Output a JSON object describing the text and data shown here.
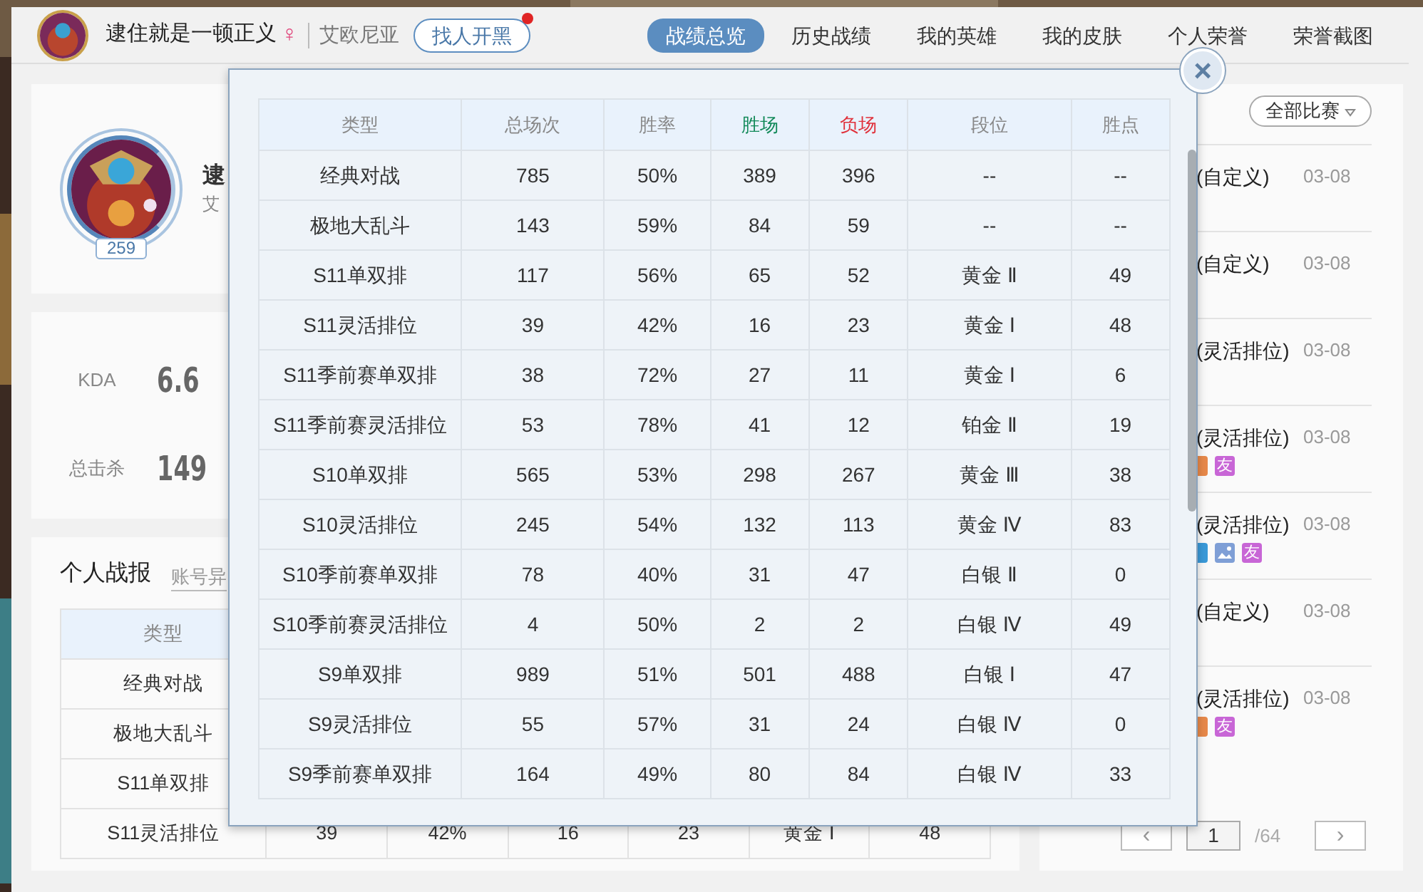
{
  "header": {
    "player_name": "逮住就是一顿正义",
    "gender_symbol": "♀",
    "server": "艾欧尼亚",
    "team_up_button": "找人开黑",
    "team_up_notification": true,
    "tabs": [
      {
        "label": "战绩总览",
        "selected": true
      },
      {
        "label": "历史战绩",
        "selected": false
      },
      {
        "label": "我的英雄",
        "selected": false
      },
      {
        "label": "我的皮肤",
        "selected": false
      },
      {
        "label": "个人荣誉",
        "selected": false
      },
      {
        "label": "荣誉截图",
        "selected": false
      }
    ]
  },
  "profile": {
    "level": "259",
    "name_visible": "逮",
    "server_visible": "艾"
  },
  "stats": [
    {
      "label": "KDA",
      "value": "6.6"
    },
    {
      "label": "总击杀",
      "value": "149"
    }
  ],
  "report": {
    "title": "个人战报",
    "link_visible": "账号异",
    "column_1": "类型",
    "rows": [
      {
        "cells": [
          "经典对战"
        ]
      },
      {
        "cells": [
          "极地大乱斗"
        ]
      },
      {
        "cells": [
          "S11单双排"
        ]
      },
      {
        "cells": [
          "S11灵活排位",
          "39",
          "42%",
          "16",
          "23",
          "黄金 Ⅰ",
          "48"
        ]
      }
    ]
  },
  "matches": {
    "filter": "全部比赛",
    "items": [
      {
        "mode": "(自定义)",
        "date": "03-08"
      },
      {
        "mode": "(自定义)",
        "date": "03-08"
      },
      {
        "mode": "(灵活排位)",
        "date": "03-08"
      },
      {
        "mode": "(灵活排位)",
        "date": "03-08",
        "tags": [
          {
            "kind": "square",
            "color": "#e8894a"
          },
          {
            "kind": "text",
            "label": "友",
            "color": "#c866d6"
          }
        ]
      },
      {
        "mode": "(灵活排位)",
        "date": "03-08",
        "tags": [
          {
            "kind": "square",
            "color": "#3a9ad9"
          },
          {
            "kind": "picture",
            "color": "#7f9fd6"
          },
          {
            "kind": "text",
            "label": "友",
            "color": "#c866d6"
          }
        ]
      },
      {
        "mode": "(自定义)",
        "date": "03-08"
      },
      {
        "mode": "(灵活排位)",
        "date": "03-08",
        "tags": [
          {
            "kind": "square",
            "color": "#e8894a"
          },
          {
            "kind": "text",
            "label": "友",
            "color": "#c866d6"
          }
        ]
      }
    ],
    "pager": {
      "prev": "‹",
      "page": "1",
      "total": "/64",
      "next": "›"
    }
  },
  "modal": {
    "close": "×",
    "columns": [
      {
        "label": "类型",
        "color": "#888888"
      },
      {
        "label": "总场次",
        "color": "#888888"
      },
      {
        "label": "胜率",
        "color": "#888888"
      },
      {
        "label": "胜场",
        "color": "#138a5a"
      },
      {
        "label": "负场",
        "color": "#e0323c"
      },
      {
        "label": "段位",
        "color": "#888888"
      },
      {
        "label": "胜点",
        "color": "#888888"
      }
    ],
    "rows": [
      [
        "经典对战",
        "785",
        "50%",
        "389",
        "396",
        "--",
        "--"
      ],
      [
        "极地大乱斗",
        "143",
        "59%",
        "84",
        "59",
        "--",
        "--"
      ],
      [
        "S11单双排",
        "117",
        "56%",
        "65",
        "52",
        "黄金 Ⅱ",
        "49"
      ],
      [
        "S11灵活排位",
        "39",
        "42%",
        "16",
        "23",
        "黄金 Ⅰ",
        "48"
      ],
      [
        "S11季前赛单双排",
        "38",
        "72%",
        "27",
        "11",
        "黄金 Ⅰ",
        "6"
      ],
      [
        "S11季前赛灵活排位",
        "53",
        "78%",
        "41",
        "12",
        "铂金 Ⅱ",
        "19"
      ],
      [
        "S10单双排",
        "565",
        "53%",
        "298",
        "267",
        "黄金 Ⅲ",
        "38"
      ],
      [
        "S10灵活排位",
        "245",
        "54%",
        "132",
        "113",
        "黄金 Ⅳ",
        "83"
      ],
      [
        "S10季前赛单双排",
        "78",
        "40%",
        "31",
        "47",
        "白银 Ⅱ",
        "0"
      ],
      [
        "S10季前赛灵活排位",
        "4",
        "50%",
        "2",
        "2",
        "白银 Ⅳ",
        "49"
      ],
      [
        "S9单双排",
        "989",
        "51%",
        "501",
        "488",
        "白银 Ⅰ",
        "47"
      ],
      [
        "S9灵活排位",
        "55",
        "57%",
        "31",
        "24",
        "白银 Ⅳ",
        "0"
      ],
      [
        "S9季前赛单双排",
        "164",
        "49%",
        "80",
        "84",
        "白银 Ⅳ",
        "33"
      ]
    ]
  }
}
